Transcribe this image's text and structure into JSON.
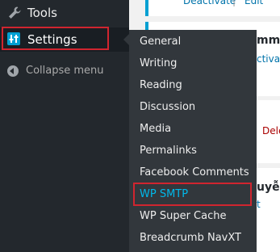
{
  "sidebar": {
    "tools_label": "Tools",
    "settings_label": "Settings",
    "collapse_label": "Collapse menu"
  },
  "submenu": {
    "items": [
      {
        "label": "General"
      },
      {
        "label": "Writing"
      },
      {
        "label": "Reading"
      },
      {
        "label": "Discussion"
      },
      {
        "label": "Media"
      },
      {
        "label": "Permalinks"
      },
      {
        "label": "Facebook Comments"
      },
      {
        "label": "WP SMTP"
      },
      {
        "label": "WP Super Cache"
      },
      {
        "label": "Breadcrumb NavXT"
      }
    ]
  },
  "content": {
    "row1_deactivate": "Deactivate",
    "row1_sep": "|",
    "row1_edit": "Edit",
    "row2_title_fragment": "mme",
    "row2_deactivate_fragment": "ctivate",
    "row3_delete_fragment": "Dele",
    "row4_title_fragment": "uyễn",
    "row4_link_fragment": "t"
  },
  "colors": {
    "sidebar_bg": "#23282d",
    "submenu_bg": "#32373c",
    "active_item": "#00b9eb",
    "highlight_outline": "#d0252f"
  }
}
